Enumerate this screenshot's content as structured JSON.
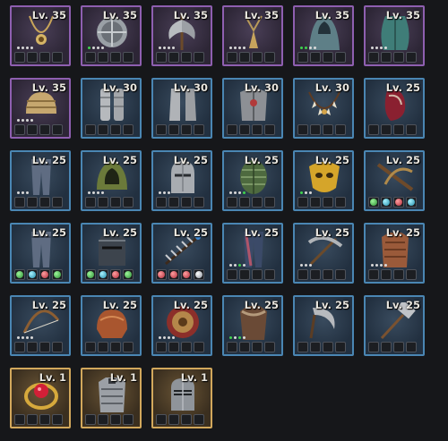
{
  "inventory": [
    {
      "level": "Lv. 35",
      "rarity": "purple",
      "icon": "necklace-icon",
      "dots": "wwww",
      "gems": []
    },
    {
      "level": "Lv. 35",
      "rarity": "purple",
      "icon": "round-shield-icon",
      "dots": "gwww",
      "gems": []
    },
    {
      "level": "Lv. 35",
      "rarity": "purple",
      "icon": "battle-axe-icon",
      "dots": "wwww",
      "gems": []
    },
    {
      "level": "Lv. 35",
      "rarity": "purple",
      "icon": "amulet-icon",
      "dots": "wwww",
      "gems": []
    },
    {
      "level": "Lv. 35",
      "rarity": "purple",
      "icon": "hooded-cloak-icon",
      "dots": "ggww",
      "gems": []
    },
    {
      "level": "Lv. 35",
      "rarity": "purple",
      "icon": "cloak-icon",
      "dots": "wwww",
      "gems": []
    },
    {
      "level": "Lv. 35",
      "rarity": "purple",
      "icon": "wrapped-cap-icon",
      "dots": "wwww",
      "gems": []
    },
    {
      "level": "Lv. 30",
      "rarity": "blue",
      "icon": "gauntlets-icon",
      "dots": "",
      "gems": []
    },
    {
      "level": "Lv. 30",
      "rarity": "blue",
      "icon": "greaves-icon",
      "dots": "",
      "gems": []
    },
    {
      "level": "Lv. 30",
      "rarity": "blue",
      "icon": "plate-armor-icon",
      "dots": "",
      "gems": []
    },
    {
      "level": "Lv. 30",
      "rarity": "blue",
      "icon": "tooth-necklace-icon",
      "dots": "",
      "gems": []
    },
    {
      "level": "Lv. 25",
      "rarity": "blue",
      "icon": "bracer-icon",
      "dots": "",
      "gems": []
    },
    {
      "level": "Lv. 25",
      "rarity": "blue",
      "icon": "leggings-icon",
      "dots": "www",
      "gems": []
    },
    {
      "level": "Lv. 25",
      "rarity": "blue",
      "icon": "hood-icon",
      "dots": "wwww",
      "gems": []
    },
    {
      "level": "Lv. 25",
      "rarity": "blue",
      "icon": "knight-helm-icon",
      "dots": "www",
      "gems": []
    },
    {
      "level": "Lv. 25",
      "rarity": "blue",
      "icon": "scale-shield-icon",
      "dots": "wwwg",
      "gems": []
    },
    {
      "level": "Lv. 25",
      "rarity": "blue",
      "icon": "golden-mask-icon",
      "dots": "gww",
      "gems": []
    },
    {
      "level": "Lv. 25",
      "rarity": "blue",
      "icon": "crossbow-icon",
      "dots": "",
      "gems": [
        "green",
        "teal",
        "red",
        "teal"
      ]
    },
    {
      "level": "Lv. 25",
      "rarity": "blue",
      "icon": "leggings-icon",
      "dots": "",
      "gems": [
        "green",
        "teal",
        "red",
        "green"
      ]
    },
    {
      "level": "Lv. 25",
      "rarity": "blue",
      "icon": "war-helm-icon",
      "dots": "",
      "gems": [
        "green",
        "teal",
        "red",
        "green"
      ]
    },
    {
      "level": "Lv. 25",
      "rarity": "blue",
      "icon": "claw-weapon-icon",
      "dots": "",
      "gems": [
        "red",
        "red",
        "red",
        "white"
      ]
    },
    {
      "level": "Lv. 25",
      "rarity": "blue",
      "icon": "cloth-pants-icon",
      "dots": "wwgw",
      "gems": []
    },
    {
      "level": "Lv. 25",
      "rarity": "blue",
      "icon": "pickaxe-icon",
      "dots": "www",
      "gems": []
    },
    {
      "level": "Lv. 25",
      "rarity": "blue",
      "icon": "leather-armor-icon",
      "dots": "wwww",
      "gems": []
    },
    {
      "level": "Lv. 25",
      "rarity": "blue",
      "icon": "longbow-icon",
      "dots": "wwww",
      "gems": []
    },
    {
      "level": "Lv. 25",
      "rarity": "blue",
      "icon": "pauldrons-icon",
      "dots": "",
      "gems": []
    },
    {
      "level": "Lv. 25",
      "rarity": "blue",
      "icon": "rune-shield-icon",
      "dots": "wwww",
      "gems": []
    },
    {
      "level": "Lv. 25",
      "rarity": "blue",
      "icon": "fur-armor-icon",
      "dots": "gwgw",
      "gems": []
    },
    {
      "level": "Lv. 25",
      "rarity": "blue",
      "icon": "sickle-icon",
      "dots": "",
      "gems": []
    },
    {
      "level": "Lv. 25",
      "rarity": "blue",
      "icon": "hammer-icon",
      "dots": "",
      "gems": []
    },
    {
      "level": "Lv. 1",
      "rarity": "gold",
      "icon": "ruby-ring-icon",
      "dots": "",
      "gems": []
    },
    {
      "level": "Lv. 1",
      "rarity": "gold",
      "icon": "steel-armor-icon",
      "dots": "",
      "gems": []
    },
    {
      "level": "Lv. 1",
      "rarity": "gold",
      "icon": "great-helm-icon",
      "dots": "",
      "gems": []
    }
  ]
}
